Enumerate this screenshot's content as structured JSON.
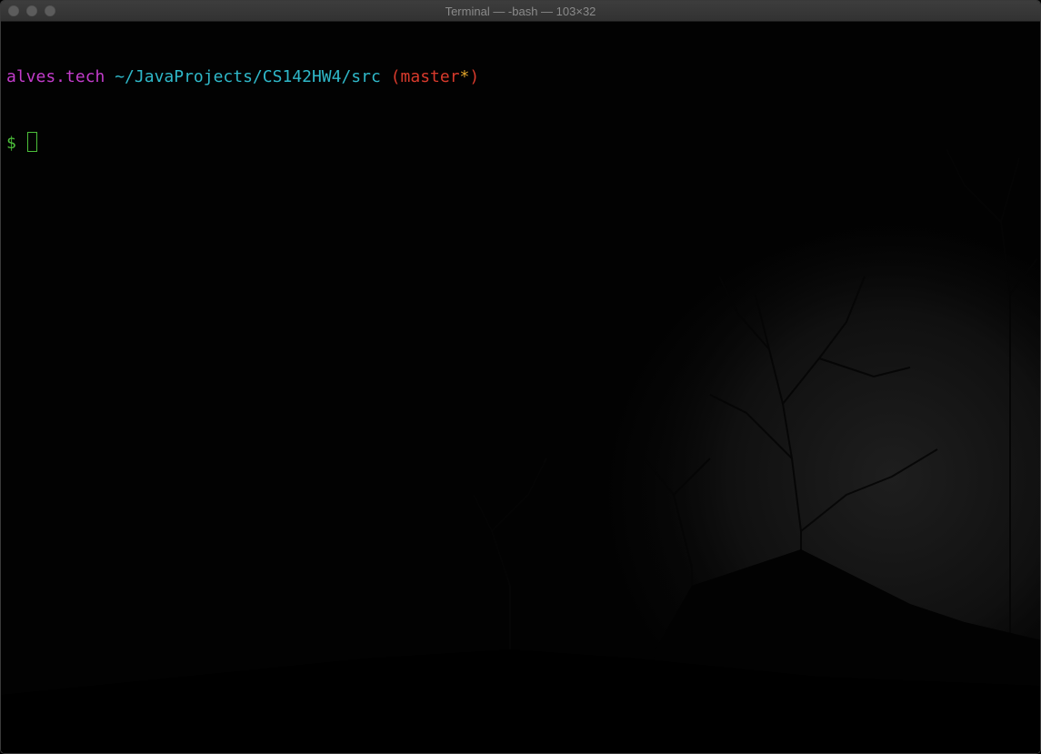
{
  "window": {
    "title": "Terminal — -bash — 103×32",
    "traffic_lights": [
      "close",
      "minimize",
      "zoom"
    ]
  },
  "terminal": {
    "prompt": {
      "user_host": "alves.tech",
      "path": "~/JavaProjects/CS142HW4/src",
      "branch_open": "(",
      "branch": "master",
      "dirty_marker": "*",
      "branch_close": ")",
      "symbol": "$"
    },
    "input_value": ""
  },
  "colors": {
    "user_host": "#c33ccb",
    "path": "#2fb8c9",
    "branch": "#d83a2c",
    "dirty_marker": "#e1a42a",
    "prompt_symbol": "#4cbf3a",
    "background": "#000000"
  },
  "background_image": "dark-night-trees-moon"
}
